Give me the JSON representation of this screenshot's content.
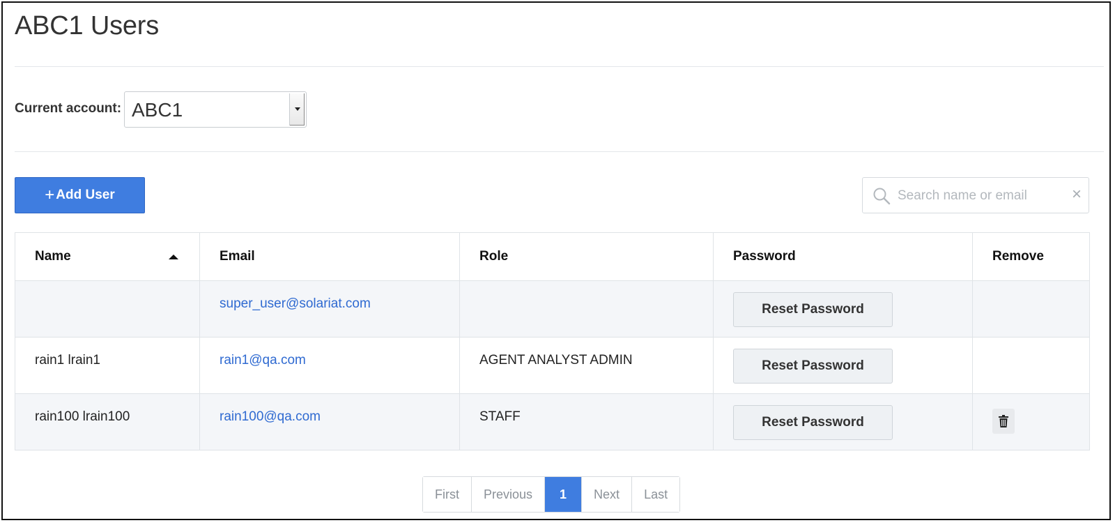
{
  "page": {
    "title": "ABC1 Users"
  },
  "account": {
    "label": "Current account:",
    "selected": "ABC1"
  },
  "toolbar": {
    "add_user_plus": "+",
    "add_user_label": "Add User",
    "search_placeholder": "Search name or email",
    "search_value": "",
    "clear_label": "×"
  },
  "table": {
    "headers": {
      "name": "Name",
      "email": "Email",
      "role": "Role",
      "password": "Password",
      "remove": "Remove"
    },
    "sort": {
      "column": "name",
      "direction": "ascending"
    },
    "rows": [
      {
        "name": "",
        "email": "super_user@solariat.com",
        "role": "",
        "reset_label": "Reset Password",
        "removable": false
      },
      {
        "name": "rain1 lrain1",
        "email": "rain1@qa.com",
        "role": "AGENT ANALYST ADMIN",
        "reset_label": "Reset Password",
        "removable": false
      },
      {
        "name": "rain100 lrain100",
        "email": "rain100@qa.com",
        "role": "STAFF",
        "reset_label": "Reset Password",
        "removable": true
      }
    ]
  },
  "pagination": {
    "first": "First",
    "previous": "Previous",
    "current": "1",
    "next": "Next",
    "last": "Last"
  },
  "colors": {
    "primary": "#3f7de0",
    "link": "#2f6ad1",
    "row_alt": "#f4f6f9"
  },
  "icons": {
    "search": "search-icon",
    "clear": "close-icon",
    "sort": "sort-ascending-icon",
    "remove": "trash-icon",
    "select": "chevron-down-icon"
  }
}
